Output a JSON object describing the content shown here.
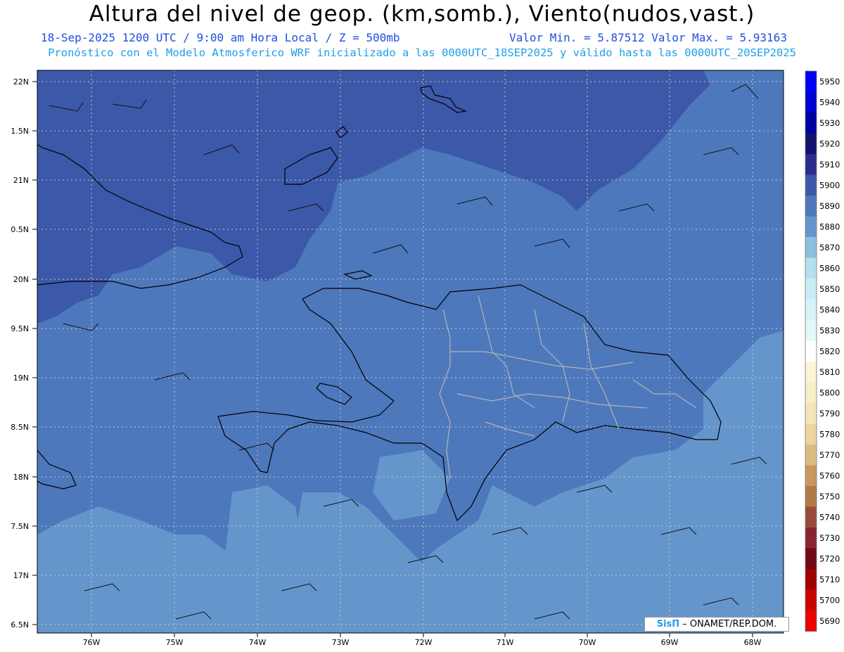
{
  "header": {
    "title": "Altura del nivel de geop. (km,somb.), Viento(nudos,vast.)",
    "date_info": "18-Sep-2025  1200 UTC / 9:00 am Hora Local / Z = 500mb",
    "minmax": "Valor Min. = 5.87512  Valor Max. = 5.93163",
    "model_info": "Pronóstico con el Modelo Atmosferico WRF inicializado a las 0000UTC_18SEP2025 y válido hasta las  0000UTC_20SEP2025"
  },
  "map": {
    "lat_labels": [
      "22N",
      "1.5N",
      "21N",
      "0.5N",
      "20N",
      "9.5N",
      "19N",
      "8.5N",
      "18N",
      "7.5N",
      "17N",
      "6.5N"
    ],
    "lon_labels": [
      "76W",
      "75W",
      "74W",
      "73W",
      "72W",
      "71W",
      "70W",
      "69W",
      "68W"
    ],
    "colors": {
      "level_5900": "#3c58a8",
      "level_5890": "#4d78bc",
      "level_5880": "#6496cb"
    }
  },
  "colorbar": {
    "labels": [
      "5950",
      "5940",
      "5930",
      "5920",
      "5910",
      "5900",
      "5890",
      "5880",
      "5870",
      "5860",
      "5850",
      "5840",
      "5830",
      "5820",
      "5810",
      "5800",
      "5790",
      "5780",
      "5770",
      "5760",
      "5750",
      "5740",
      "5730",
      "5720",
      "5710",
      "5700",
      "5690"
    ],
    "colors": [
      "#0000ff",
      "#0000d2",
      "#0000a0",
      "#12126e",
      "#2b2b8e",
      "#3c58a8",
      "#4d78bc",
      "#6496cb",
      "#8cbfe0",
      "#b4e0ee",
      "#c8ecf4",
      "#d6f2f6",
      "#e2f8fa",
      "#ffffff",
      "#fbf5d4",
      "#f7efc6",
      "#f3e6b6",
      "#ebd6a0",
      "#dcbd80",
      "#c8985e",
      "#b07a48",
      "#9a4a3c",
      "#8a2430",
      "#700818",
      "#a00000",
      "#cc0000",
      "#ee0000"
    ]
  },
  "credit": {
    "logo": "SisΠ",
    "text": "– ONAMET/REP.DOM."
  }
}
